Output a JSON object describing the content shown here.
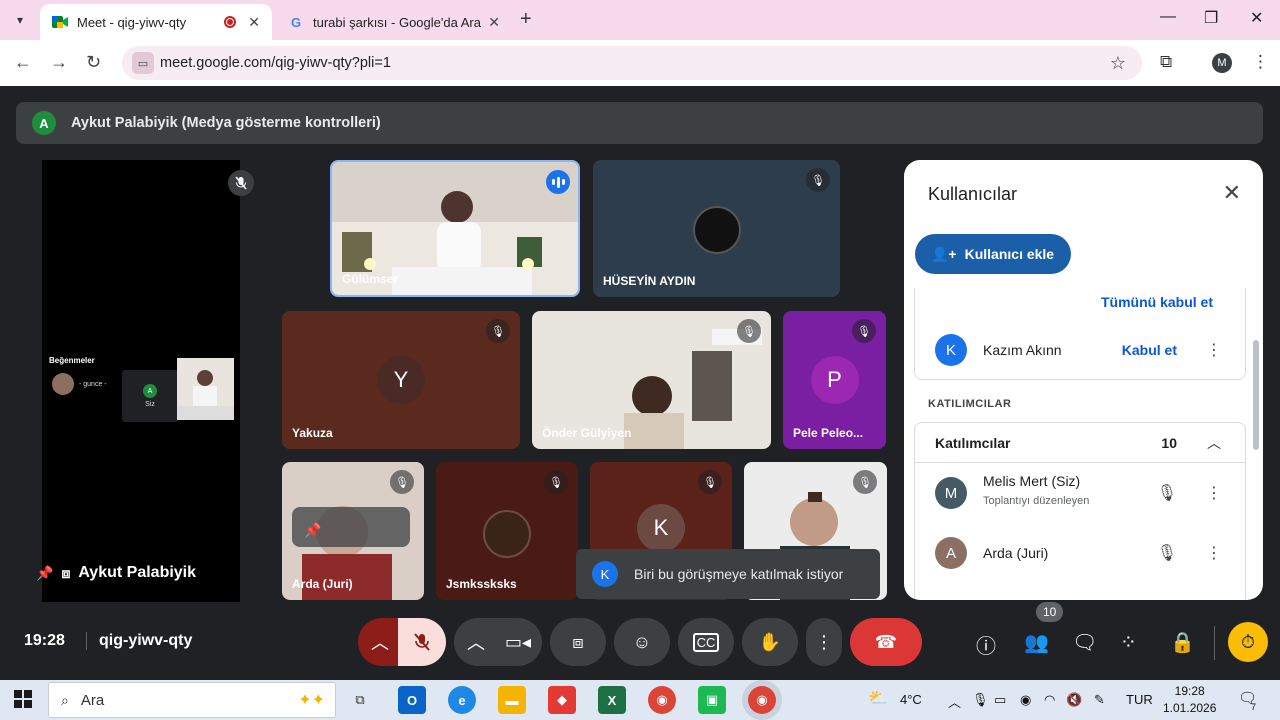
{
  "browser": {
    "tabs": [
      {
        "title": "Meet - qig-yiwv-qty",
        "active": true
      },
      {
        "title": "turabi şarkısı - Google'da Ara",
        "active": false
      }
    ],
    "url": "meet.google.com/qig-yiwv-qty?pli=1",
    "profile_initial": "M"
  },
  "meet": {
    "presenter_bar": {
      "avatar": "A",
      "text": "Aykut Palabiyik (Medya gösterme kontrolleri)"
    },
    "screen_share": {
      "likes_label": "Beğenmeler",
      "gunce_label": "- gunce -",
      "mini_avatar": "A",
      "mini_label": "Siz",
      "presenter_name": "Aykut Palabiyik"
    },
    "tiles": [
      {
        "name": "Gülümser",
        "type": "video"
      },
      {
        "name": "HÜSEYİN AYDIN",
        "type": "photo"
      },
      {
        "name": "Yakuza",
        "avatar": "Y"
      },
      {
        "name": "Önder Gülyiyen",
        "type": "video"
      },
      {
        "name": "Pele Peleo...",
        "avatar": "P"
      },
      {
        "name": "Arda (Juri)",
        "type": "video"
      },
      {
        "name": "Jsmkssksks",
        "type": "photo"
      },
      {
        "name": "",
        "avatar": "K"
      },
      {
        "name": "",
        "type": "video"
      }
    ],
    "toast": {
      "avatar": "K",
      "text": "Biri bu görüşmeye katılmak istiyor"
    },
    "panel": {
      "title": "Kullanıcılar",
      "add_button": "Kullanıcı ekle",
      "accept_all": "Tümünü kabul et",
      "waiting": [
        {
          "avatar": "K",
          "name": "Kazım Akınn",
          "action": "Kabul et"
        }
      ],
      "section_label": "KATILIMCILAR",
      "participants_header": "Katılımcılar",
      "participants_count": "10",
      "participants": [
        {
          "avatar": "M",
          "name": "Melis Mert (Siz)",
          "sub": "Toplantıyı düzenleyen"
        },
        {
          "avatar": "A",
          "name": "Arda (Juri)",
          "sub": ""
        }
      ]
    },
    "controls": {
      "time": "19:28",
      "meeting_code": "qig-yiwv-qty",
      "people_badge": "10"
    }
  },
  "taskbar": {
    "search_placeholder": "Ara",
    "weather": "4°C",
    "language": "TUR",
    "time": "19:28",
    "date": "1.01.2026",
    "notifications": "7"
  }
}
